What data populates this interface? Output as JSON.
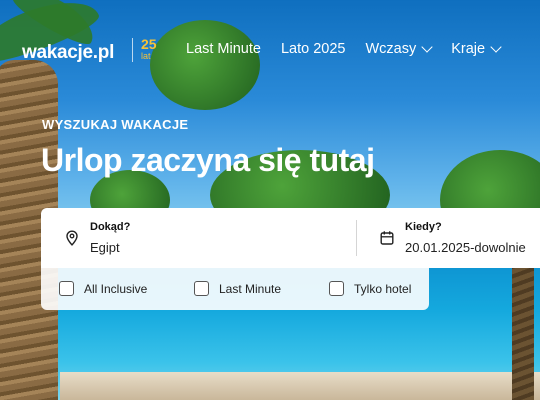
{
  "header": {
    "logo_text": "wakacje.pl",
    "anniversary_number": "25",
    "anniversary_unit": "lat",
    "nav": [
      {
        "label": "Last Minute",
        "has_dropdown": false
      },
      {
        "label": "Lato 2025",
        "has_dropdown": false
      },
      {
        "label": "Wczasy",
        "has_dropdown": true
      },
      {
        "label": "Kraje",
        "has_dropdown": true
      }
    ]
  },
  "hero": {
    "kicker": "WYSZUKAJ WAKACJE",
    "headline": "Urlop zaczyna się tutaj"
  },
  "search": {
    "destination": {
      "label": "Dokąd?",
      "value": "Egipt",
      "icon": "map-pin-icon"
    },
    "date": {
      "label": "Kiedy?",
      "value": "20.01.2025-dowolnie",
      "icon": "calendar-icon"
    }
  },
  "filters": [
    {
      "label": "All Inclusive",
      "checked": false
    },
    {
      "label": "Last Minute",
      "checked": false
    },
    {
      "label": "Tylko hotel",
      "checked": false
    }
  ],
  "colors": {
    "accent": "#f5b400",
    "text_dark": "#222222"
  }
}
